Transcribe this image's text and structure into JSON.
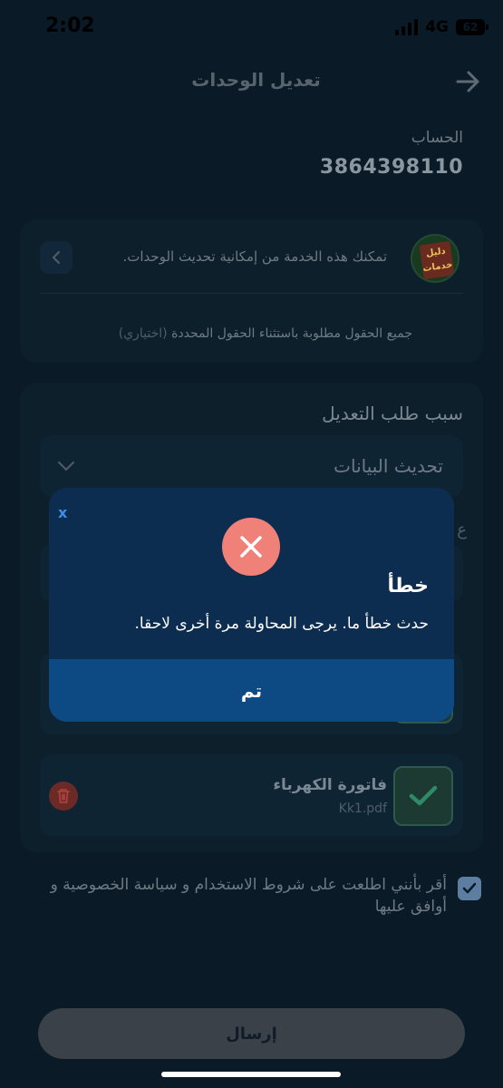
{
  "status_bar": {
    "time": "2:02",
    "network": "4G",
    "battery": "62"
  },
  "header": {
    "title": "تعديل الوحدات"
  },
  "account": {
    "label": "الحساب",
    "value": "3864398110"
  },
  "service": {
    "logo_text": "دليل خدمات",
    "description": "تمكنك هذه الخدمة من إمكانية تحديث الوحدات.",
    "required_note": "جميع الحقول مطلوبة باستثناء الحقول المحددة",
    "optional_tag": "(اختياري)"
  },
  "form": {
    "reason_label": "سبب طلب التعديل",
    "reason_value": "تحديث البيانات",
    "partial_label": "ع",
    "document": {
      "title": "فاتورة الكهرباء",
      "file_name": "Kk1.pdf"
    }
  },
  "terms": {
    "text": "أقر بأنني اطلعت على شروط الاستخدام و سياسة الخصوصية و أوافق عليها",
    "checked": true
  },
  "submit": {
    "label": "إرسال"
  },
  "modal": {
    "close_label": "x",
    "title": "خطأ",
    "message": "حدث خطأ ما. يرجى المحاولة مرة أخرى لاحقا.",
    "ok_label": "تم"
  },
  "colors": {
    "background": "#0a1a26",
    "modal": "#0c2d4f",
    "modal_button": "#0d4a83",
    "error": "#f08178",
    "success_check": "#2f8a67"
  }
}
